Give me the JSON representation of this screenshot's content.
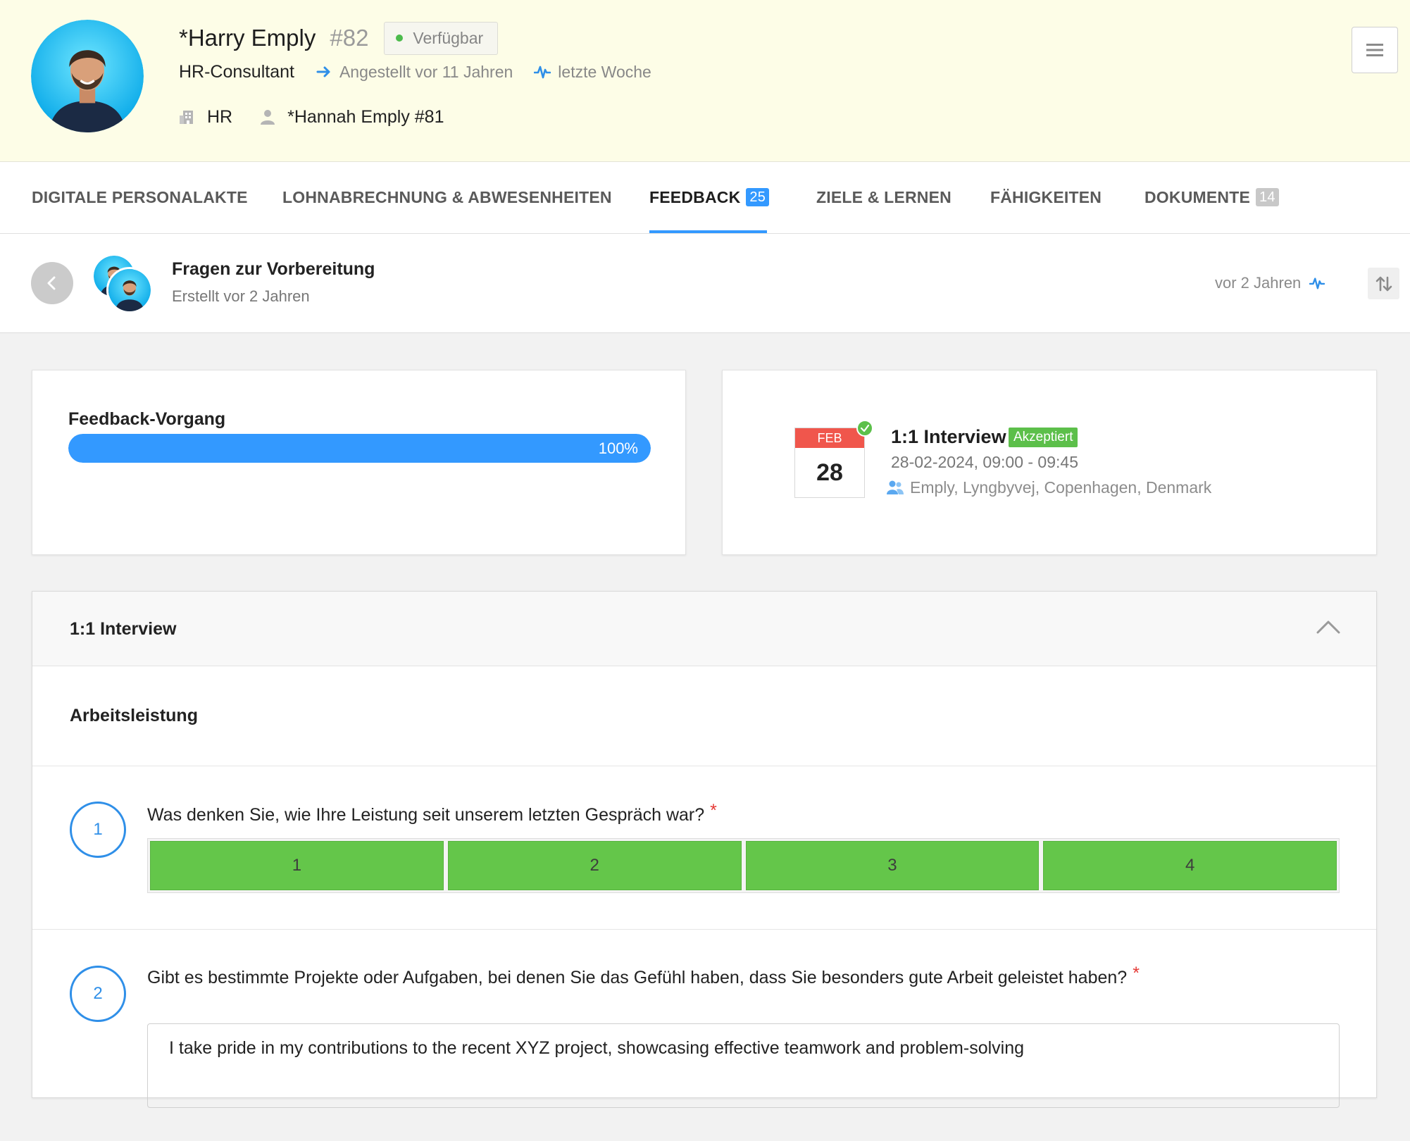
{
  "profile": {
    "name": "*Harry Emply",
    "number": "#82",
    "status": "Verfügbar",
    "title": "HR-Consultant",
    "employed": "Angestellt vor 11 Jahren",
    "activity": "letzte Woche",
    "department": "HR",
    "manager": "*Hannah Emply #81"
  },
  "tabs": [
    {
      "label": "DIGITALE PERSONALAKTE",
      "badge": ""
    },
    {
      "label": "LOHNABRECHNUNG & ABWESENHEITEN",
      "badge": ""
    },
    {
      "label": "FEEDBACK",
      "badge": "25",
      "active": true
    },
    {
      "label": "ZIELE & LERNEN",
      "badge": ""
    },
    {
      "label": "FÄHIGKEITEN",
      "badge": ""
    },
    {
      "label": "DOKUMENTE",
      "badge": "14"
    }
  ],
  "feedback": {
    "title": "Fragen zur Vorbereitung",
    "created": "Erstellt vor 2 Jahren",
    "updated": "vor 2 Jahren"
  },
  "progress": {
    "label": "Feedback-Vorgang",
    "percent": 100,
    "percent_text": "100%"
  },
  "meeting": {
    "month": "FEB",
    "day": "28",
    "title": "1:1 Interview",
    "status": "Akzeptiert",
    "datetime": "28-02-2024, 09:00 - 09:45",
    "location": "Emply, Lyngbyvej, Copenhagen, Denmark"
  },
  "interview": {
    "title": "1:1 Interview",
    "section": "Arbeitsleistung",
    "questions": [
      {
        "number": "1",
        "text": "Was denken Sie, wie Ihre Leistung seit unserem letzten Gespräch war?",
        "required_mark": "*",
        "options": [
          "1",
          "2",
          "3",
          "4"
        ]
      },
      {
        "number": "2",
        "text": "Gibt es bestimmte Projekte oder Aufgaben, bei denen Sie das Gefühl haben, dass Sie besonders gute Arbeit geleistet haben?",
        "required_mark": "*",
        "answer": "I take pride in my contributions to the recent XYZ project, showcasing effective teamwork and problem-solving"
      }
    ]
  },
  "colors": {
    "header_bg": "#fdfde7",
    "accent": "#3399ff",
    "success": "#5cbf4a",
    "option_green": "#64c64a",
    "calendar_red": "#f0564c",
    "required": "#e53935"
  },
  "icons": [
    "avatar-photo",
    "status-dot-icon",
    "arrow-right-icon",
    "activity-pulse-icon",
    "building-icon",
    "person-icon",
    "hamburger-menu-icon",
    "chevron-left-icon",
    "sort-icon",
    "calendar-icon",
    "check-icon",
    "group-icon",
    "chevron-up-icon"
  ]
}
